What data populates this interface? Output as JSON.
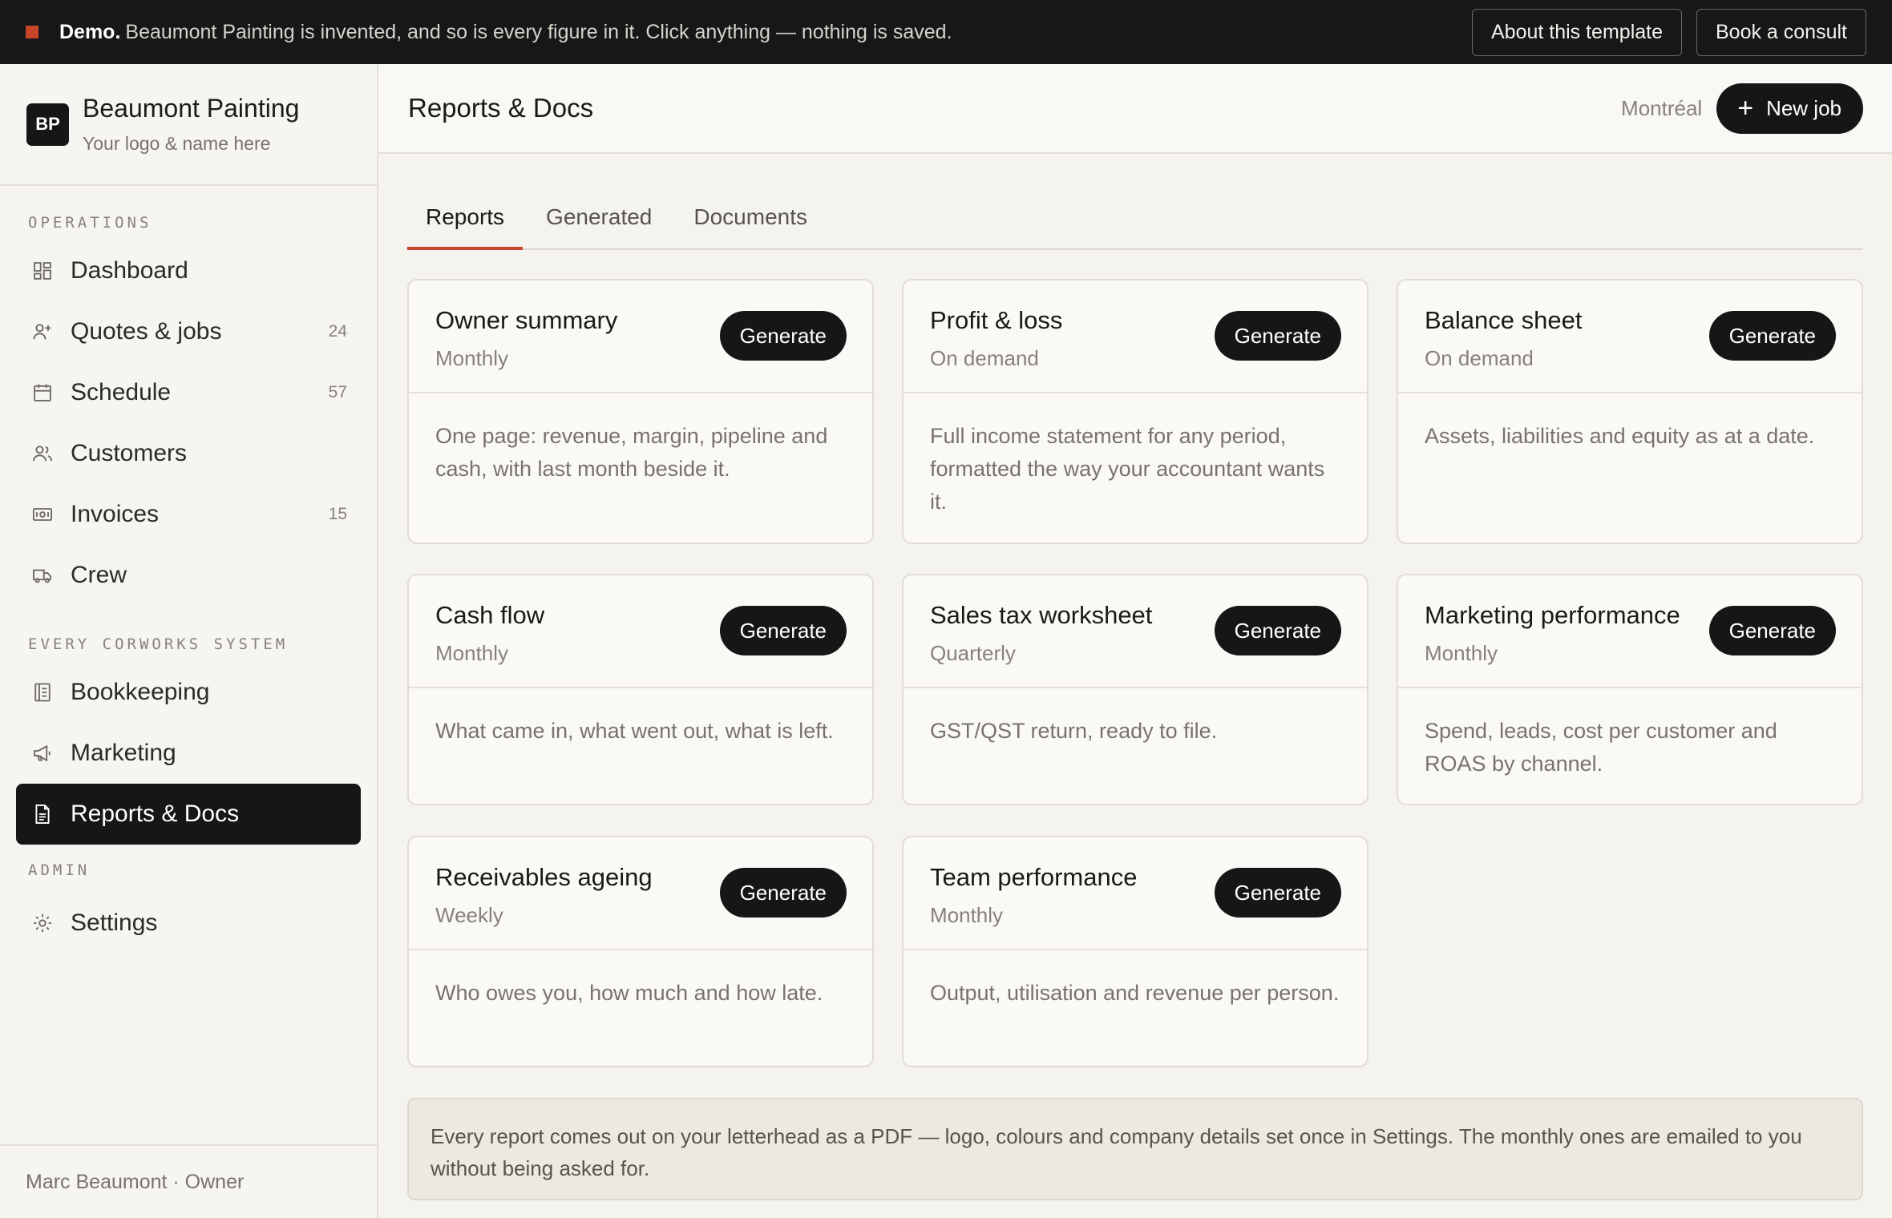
{
  "banner": {
    "label": "Demo.",
    "text": "Beaumont Painting is invented, and so is every figure in it. Click anything — nothing is saved.",
    "about_button": "About this template",
    "consult_button": "Book a consult"
  },
  "brand": {
    "initials": "BP",
    "name": "Beaumont Painting",
    "subtitle": "Your logo & name here"
  },
  "sidebar": {
    "sections": {
      "operations": "OPERATIONS",
      "system": "EVERY CORWORKS SYSTEM",
      "admin": "ADMIN"
    },
    "items": [
      {
        "label": "Dashboard",
        "icon": "dashboard-icon",
        "count": ""
      },
      {
        "label": "Quotes & jobs",
        "icon": "user-plus-icon",
        "count": "24"
      },
      {
        "label": "Schedule",
        "icon": "calendar-icon",
        "count": "57"
      },
      {
        "label": "Customers",
        "icon": "users-icon",
        "count": ""
      },
      {
        "label": "Invoices",
        "icon": "banknote-icon",
        "count": "15"
      },
      {
        "label": "Crew",
        "icon": "truck-icon",
        "count": ""
      },
      {
        "label": "Bookkeeping",
        "icon": "ledger-icon",
        "count": ""
      },
      {
        "label": "Marketing",
        "icon": "megaphone-icon",
        "count": ""
      },
      {
        "label": "Reports & Docs",
        "icon": "document-icon",
        "count": ""
      },
      {
        "label": "Settings",
        "icon": "gear-icon",
        "count": ""
      }
    ],
    "footer": "Marc Beaumont · Owner"
  },
  "header": {
    "title": "Reports & Docs",
    "city": "Montréal",
    "new_job_button": "New job"
  },
  "tabs": [
    {
      "label": "Reports",
      "active": true
    },
    {
      "label": "Generated",
      "active": false
    },
    {
      "label": "Documents",
      "active": false
    }
  ],
  "reports": [
    {
      "title": "Owner summary",
      "frequency": "Monthly",
      "description": "One page: revenue, margin, pipeline and cash, with last month beside it.",
      "button": "Generate"
    },
    {
      "title": "Profit & loss",
      "frequency": "On demand",
      "description": "Full income statement for any period, formatted the way your accountant wants it.",
      "button": "Generate"
    },
    {
      "title": "Balance sheet",
      "frequency": "On demand",
      "description": "Assets, liabilities and equity as at a date.",
      "button": "Generate"
    },
    {
      "title": "Cash flow",
      "frequency": "Monthly",
      "description": "What came in, what went out, what is left.",
      "button": "Generate"
    },
    {
      "title": "Sales tax worksheet",
      "frequency": "Quarterly",
      "description": "GST/QST return, ready to file.",
      "button": "Generate"
    },
    {
      "title": "Marketing performance",
      "frequency": "Monthly",
      "description": "Spend, leads, cost per customer and ROAS by channel.",
      "button": "Generate"
    },
    {
      "title": "Receivables ageing",
      "frequency": "Weekly",
      "description": "Who owes you, how much and how late.",
      "button": "Generate"
    },
    {
      "title": "Team performance",
      "frequency": "Monthly",
      "description": "Output, utilisation and revenue per person.",
      "button": "Generate"
    }
  ],
  "note": "Every report comes out on your letterhead as a PDF — logo, colours and company details set once in Settings. The monthly ones are emailed to you without being asked for.",
  "colors": {
    "accent": "#c8442a",
    "dark": "#161616",
    "background": "#f5f3ee"
  }
}
